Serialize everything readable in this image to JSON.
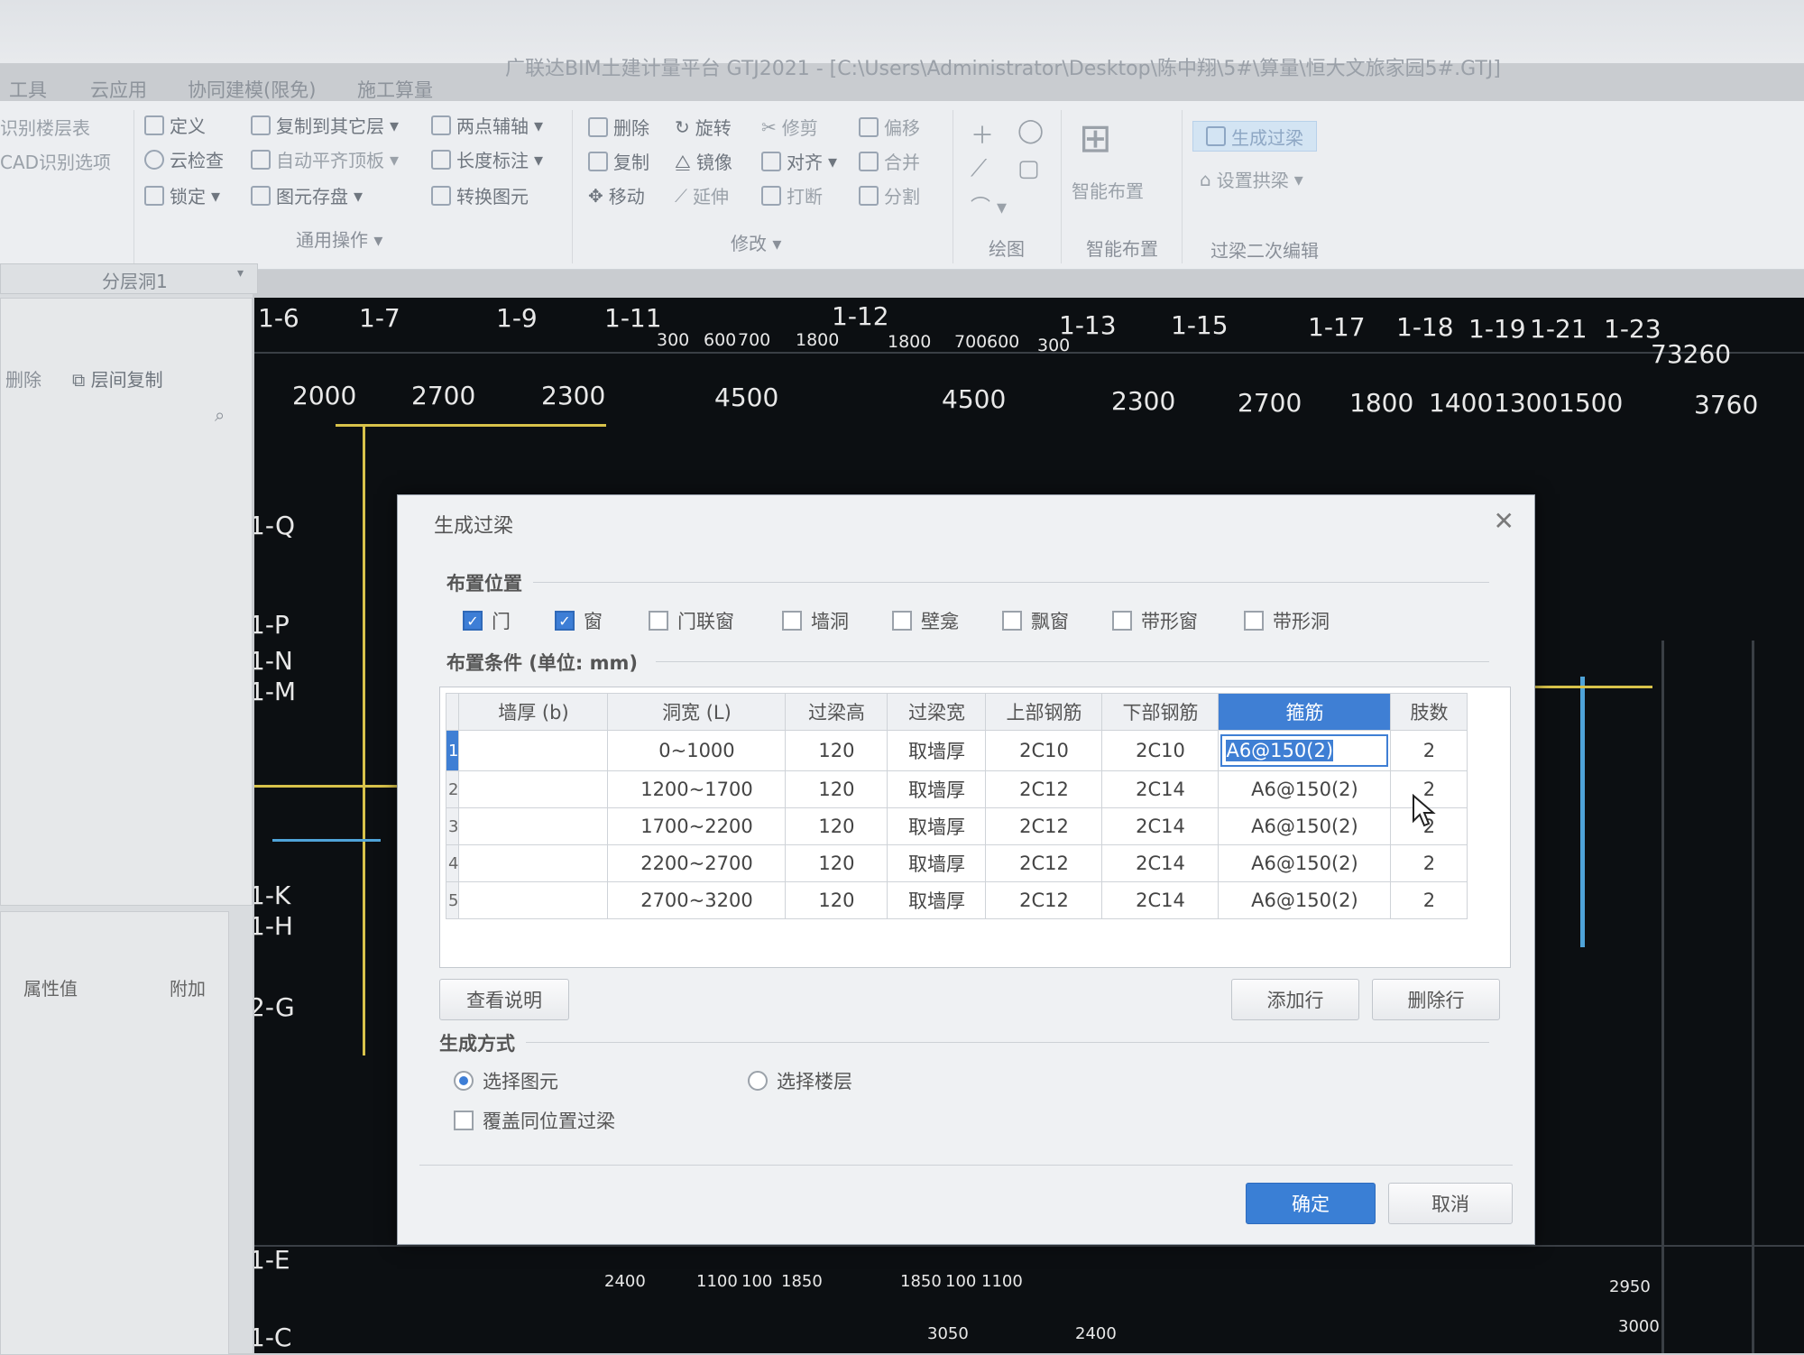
{
  "window": {
    "title": "广联达BIM土建计量平台 GTJ2021 - [C:\\Users\\Administrator\\Desktop\\陈中翔\\5#\\算量\\恒大文旅家园5#.GTJ]"
  },
  "menu": {
    "items": [
      "工具",
      "云应用",
      "协同建模(限免)",
      "施工算量"
    ]
  },
  "ribbon": {
    "left_items": [
      "识别楼层表",
      "CAD识别选项"
    ],
    "general_ops": {
      "items": [
        "定义",
        "云检查",
        "锁定",
        "复制到其它层",
        "自动平齐顶板",
        "图元存盘",
        "两点辅轴",
        "长度标注",
        "转换图元"
      ],
      "group_label": "通用操作"
    },
    "modify": {
      "items": [
        "删除",
        "复制",
        "移动",
        "旋转",
        "镜像",
        "延伸",
        "修剪",
        "对齐",
        "打断",
        "偏移",
        "合并",
        "分割"
      ],
      "group_label": "修改"
    },
    "draw": {
      "group_label": "绘图"
    },
    "smart_layout": {
      "button_label": "智能布置",
      "group_label": "智能布置"
    },
    "lintel_edit": {
      "items": [
        "生成过梁",
        "设置拱梁"
      ],
      "group_label": "过梁二次编辑"
    }
  },
  "left_panel": {
    "layer_combo": "分层洞1",
    "actions": [
      "删除",
      "层间复制"
    ],
    "prop_headers": [
      "属性值",
      "附加"
    ]
  },
  "cad": {
    "axis_labels_top": [
      "1-6",
      "1-7",
      "1-9",
      "1-11",
      "1-12",
      "1-13",
      "1-15",
      "1-17",
      "1-18",
      "1-19",
      "1-21",
      "1-23"
    ],
    "dims_top": [
      "2000",
      "2700",
      "2300",
      "4500",
      "4500",
      "2300",
      "2700",
      "1800",
      "1400",
      "1300",
      "1500",
      "3760"
    ],
    "small_dims": [
      "300",
      "600",
      "700",
      "1800",
      "1800",
      "700",
      "600",
      "300"
    ],
    "total_dim": "73260",
    "axis_labels_left": [
      "1-Q",
      "1-P",
      "1-N",
      "1-M",
      "1-K",
      "1-H",
      "2-G",
      "1-E",
      "1-C"
    ],
    "bottom_dims": [
      "2400",
      "1100",
      "100",
      "1850",
      "1850",
      "100",
      "1100",
      "2950",
      "3000",
      "3050",
      "2400"
    ]
  },
  "dialog": {
    "title": "生成过梁",
    "placement_section": "布置位置",
    "checkboxes": [
      {
        "label": "门",
        "checked": true
      },
      {
        "label": "窗",
        "checked": true
      },
      {
        "label": "门联窗",
        "checked": false
      },
      {
        "label": "墙洞",
        "checked": false
      },
      {
        "label": "壁龛",
        "checked": false
      },
      {
        "label": "飘窗",
        "checked": false
      },
      {
        "label": "带形窗",
        "checked": false
      },
      {
        "label": "带形洞",
        "checked": false
      }
    ],
    "conditions_section": "布置条件 (单位: mm)",
    "table": {
      "headers": [
        "墙厚 (b)",
        "洞宽 (L)",
        "过梁高",
        "过梁宽",
        "上部钢筋",
        "下部钢筋",
        "箍筋",
        "肢数"
      ],
      "selected_header": "箍筋",
      "rows": [
        {
          "n": "1",
          "thickness": "",
          "width": "0~1000",
          "height": "120",
          "beam_width": "取墙厚",
          "top": "2C10",
          "bottom": "2C10",
          "stirrup": "A6@150(2)",
          "legs": "2"
        },
        {
          "n": "2",
          "thickness": "",
          "width": "1200~1700",
          "height": "120",
          "beam_width": "取墙厚",
          "top": "2C12",
          "bottom": "2C14",
          "stirrup": "A6@150(2)",
          "legs": "2"
        },
        {
          "n": "3",
          "thickness": "",
          "width": "1700~2200",
          "height": "120",
          "beam_width": "取墙厚",
          "top": "2C12",
          "bottom": "2C14",
          "stirrup": "A6@150(2)",
          "legs": "2"
        },
        {
          "n": "4",
          "thickness": "",
          "width": "2200~2700",
          "height": "120",
          "beam_width": "取墙厚",
          "top": "2C12",
          "bottom": "2C14",
          "stirrup": "A6@150(2)",
          "legs": "2"
        },
        {
          "n": "5",
          "thickness": "",
          "width": "2700~3200",
          "height": "120",
          "beam_width": "取墙厚",
          "top": "2C12",
          "bottom": "2C14",
          "stirrup": "A6@150(2)",
          "legs": "2"
        }
      ]
    },
    "buttons": {
      "view_help": "查看说明",
      "add_row": "添加行",
      "delete_row": "删除行",
      "ok": "确定",
      "cancel": "取消"
    },
    "mode_section": "生成方式",
    "radios": [
      {
        "label": "选择图元",
        "checked": true
      },
      {
        "label": "选择楼层",
        "checked": false
      }
    ],
    "override_checkbox": {
      "label": "覆盖同位置过梁",
      "checked": false
    }
  },
  "colors": {
    "accent": "#3a7fd5",
    "cad_bg": "#0c0f12",
    "cad_yellow": "#d8c24a",
    "cad_cyan": "#4fa3d8"
  }
}
